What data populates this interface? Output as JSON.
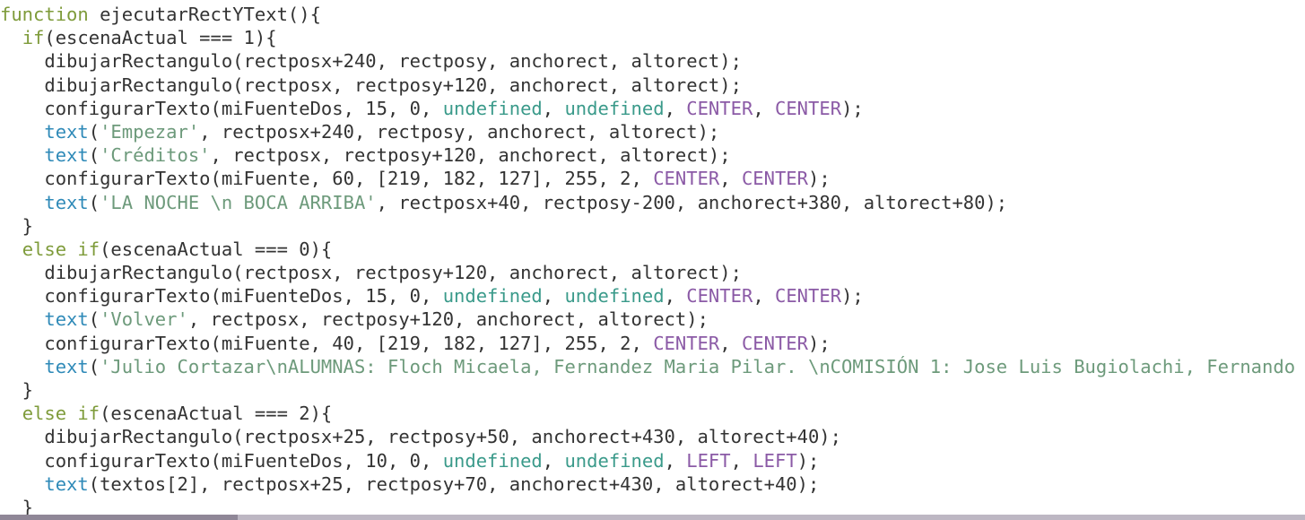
{
  "colors": {
    "keyword": "#7e9b3a",
    "builtin": "#2f8ab8",
    "string": "#6d9a7b",
    "undefined": "#3a9a8a",
    "constant": "#8b5aa6",
    "plain": "#333333",
    "background": "#ffffff"
  },
  "code_lines": [
    [
      [
        "kw",
        "function"
      ],
      [
        "plain",
        " ejecutarRectYText(){"
      ]
    ],
    [
      [
        "plain",
        "  "
      ],
      [
        "kw",
        "if"
      ],
      [
        "plain",
        "(escenaActual === 1){"
      ]
    ],
    [
      [
        "plain",
        "    dibujarRectangulo(rectposx+240, rectposy, anchorect, altorect);"
      ]
    ],
    [
      [
        "plain",
        "    dibujarRectangulo(rectposx, rectposy+120, anchorect, altorect);"
      ]
    ],
    [
      [
        "plain",
        "    configurarTexto(miFuenteDos, 15, 0, "
      ],
      [
        "undef",
        "undefined"
      ],
      [
        "plain",
        ", "
      ],
      [
        "undef",
        "undefined"
      ],
      [
        "plain",
        ", "
      ],
      [
        "const",
        "CENTER"
      ],
      [
        "plain",
        ", "
      ],
      [
        "const",
        "CENTER"
      ],
      [
        "plain",
        ");"
      ]
    ],
    [
      [
        "plain",
        "    "
      ],
      [
        "builtin",
        "text"
      ],
      [
        "plain",
        "("
      ],
      [
        "str",
        "'Empezar'"
      ],
      [
        "plain",
        ", rectposx+240, rectposy, anchorect, altorect);"
      ]
    ],
    [
      [
        "plain",
        "    "
      ],
      [
        "builtin",
        "text"
      ],
      [
        "plain",
        "("
      ],
      [
        "str",
        "'Créditos'"
      ],
      [
        "plain",
        ", rectposx, rectposy+120, anchorect, altorect);"
      ]
    ],
    [
      [
        "plain",
        "    configurarTexto(miFuente, 60, [219, 182, 127], 255, 2, "
      ],
      [
        "const",
        "CENTER"
      ],
      [
        "plain",
        ", "
      ],
      [
        "const",
        "CENTER"
      ],
      [
        "plain",
        ");"
      ]
    ],
    [
      [
        "plain",
        "    "
      ],
      [
        "builtin",
        "text"
      ],
      [
        "plain",
        "("
      ],
      [
        "str",
        "'LA NOCHE \\n BOCA ARRIBA'"
      ],
      [
        "plain",
        ", rectposx+40, rectposy-200, anchorect+380, altorect+80);"
      ]
    ],
    [
      [
        "plain",
        "  }"
      ]
    ],
    [
      [
        "plain",
        "  "
      ],
      [
        "kw",
        "else if"
      ],
      [
        "plain",
        "(escenaActual === 0){"
      ]
    ],
    [
      [
        "plain",
        "    dibujarRectangulo(rectposx, rectposy+120, anchorect, altorect);"
      ]
    ],
    [
      [
        "plain",
        "    configurarTexto(miFuenteDos, 15, 0, "
      ],
      [
        "undef",
        "undefined"
      ],
      [
        "plain",
        ", "
      ],
      [
        "undef",
        "undefined"
      ],
      [
        "plain",
        ", "
      ],
      [
        "const",
        "CENTER"
      ],
      [
        "plain",
        ", "
      ],
      [
        "const",
        "CENTER"
      ],
      [
        "plain",
        ");"
      ]
    ],
    [
      [
        "plain",
        "    "
      ],
      [
        "builtin",
        "text"
      ],
      [
        "plain",
        "("
      ],
      [
        "str",
        "'Volver'"
      ],
      [
        "plain",
        ", rectposx, rectposy+120, anchorect, altorect);"
      ]
    ],
    [
      [
        "plain",
        "    configurarTexto(miFuente, 40, [219, 182, 127], 255, 2, "
      ],
      [
        "const",
        "CENTER"
      ],
      [
        "plain",
        ", "
      ],
      [
        "const",
        "CENTER"
      ],
      [
        "plain",
        ");"
      ]
    ],
    [
      [
        "plain",
        "    "
      ],
      [
        "builtin",
        "text"
      ],
      [
        "plain",
        "("
      ],
      [
        "str",
        "'Julio Cortazar\\nALUMNAS: Floch Micaela, Fernandez Maria Pilar. \\nCOMISIÓN 1: Jose Luis Bugiolachi, Fernando"
      ]
    ],
    [
      [
        "plain",
        "  }"
      ]
    ],
    [
      [
        "plain",
        "  "
      ],
      [
        "kw",
        "else if"
      ],
      [
        "plain",
        "(escenaActual === 2){"
      ]
    ],
    [
      [
        "plain",
        "    dibujarRectangulo(rectposx+25, rectposy+50, anchorect+430, altorect+40);"
      ]
    ],
    [
      [
        "plain",
        "    configurarTexto(miFuenteDos, 10, 0, "
      ],
      [
        "undef",
        "undefined"
      ],
      [
        "plain",
        ", "
      ],
      [
        "undef",
        "undefined"
      ],
      [
        "plain",
        ", "
      ],
      [
        "const",
        "LEFT"
      ],
      [
        "plain",
        ", "
      ],
      [
        "const",
        "LEFT"
      ],
      [
        "plain",
        ");"
      ]
    ],
    [
      [
        "plain",
        "    "
      ],
      [
        "builtin",
        "text"
      ],
      [
        "plain",
        "(textos[2], rectposx+25, rectposy+70, anchorect+430, altorect+40);"
      ]
    ],
    [
      [
        "plain",
        "  }"
      ]
    ]
  ]
}
